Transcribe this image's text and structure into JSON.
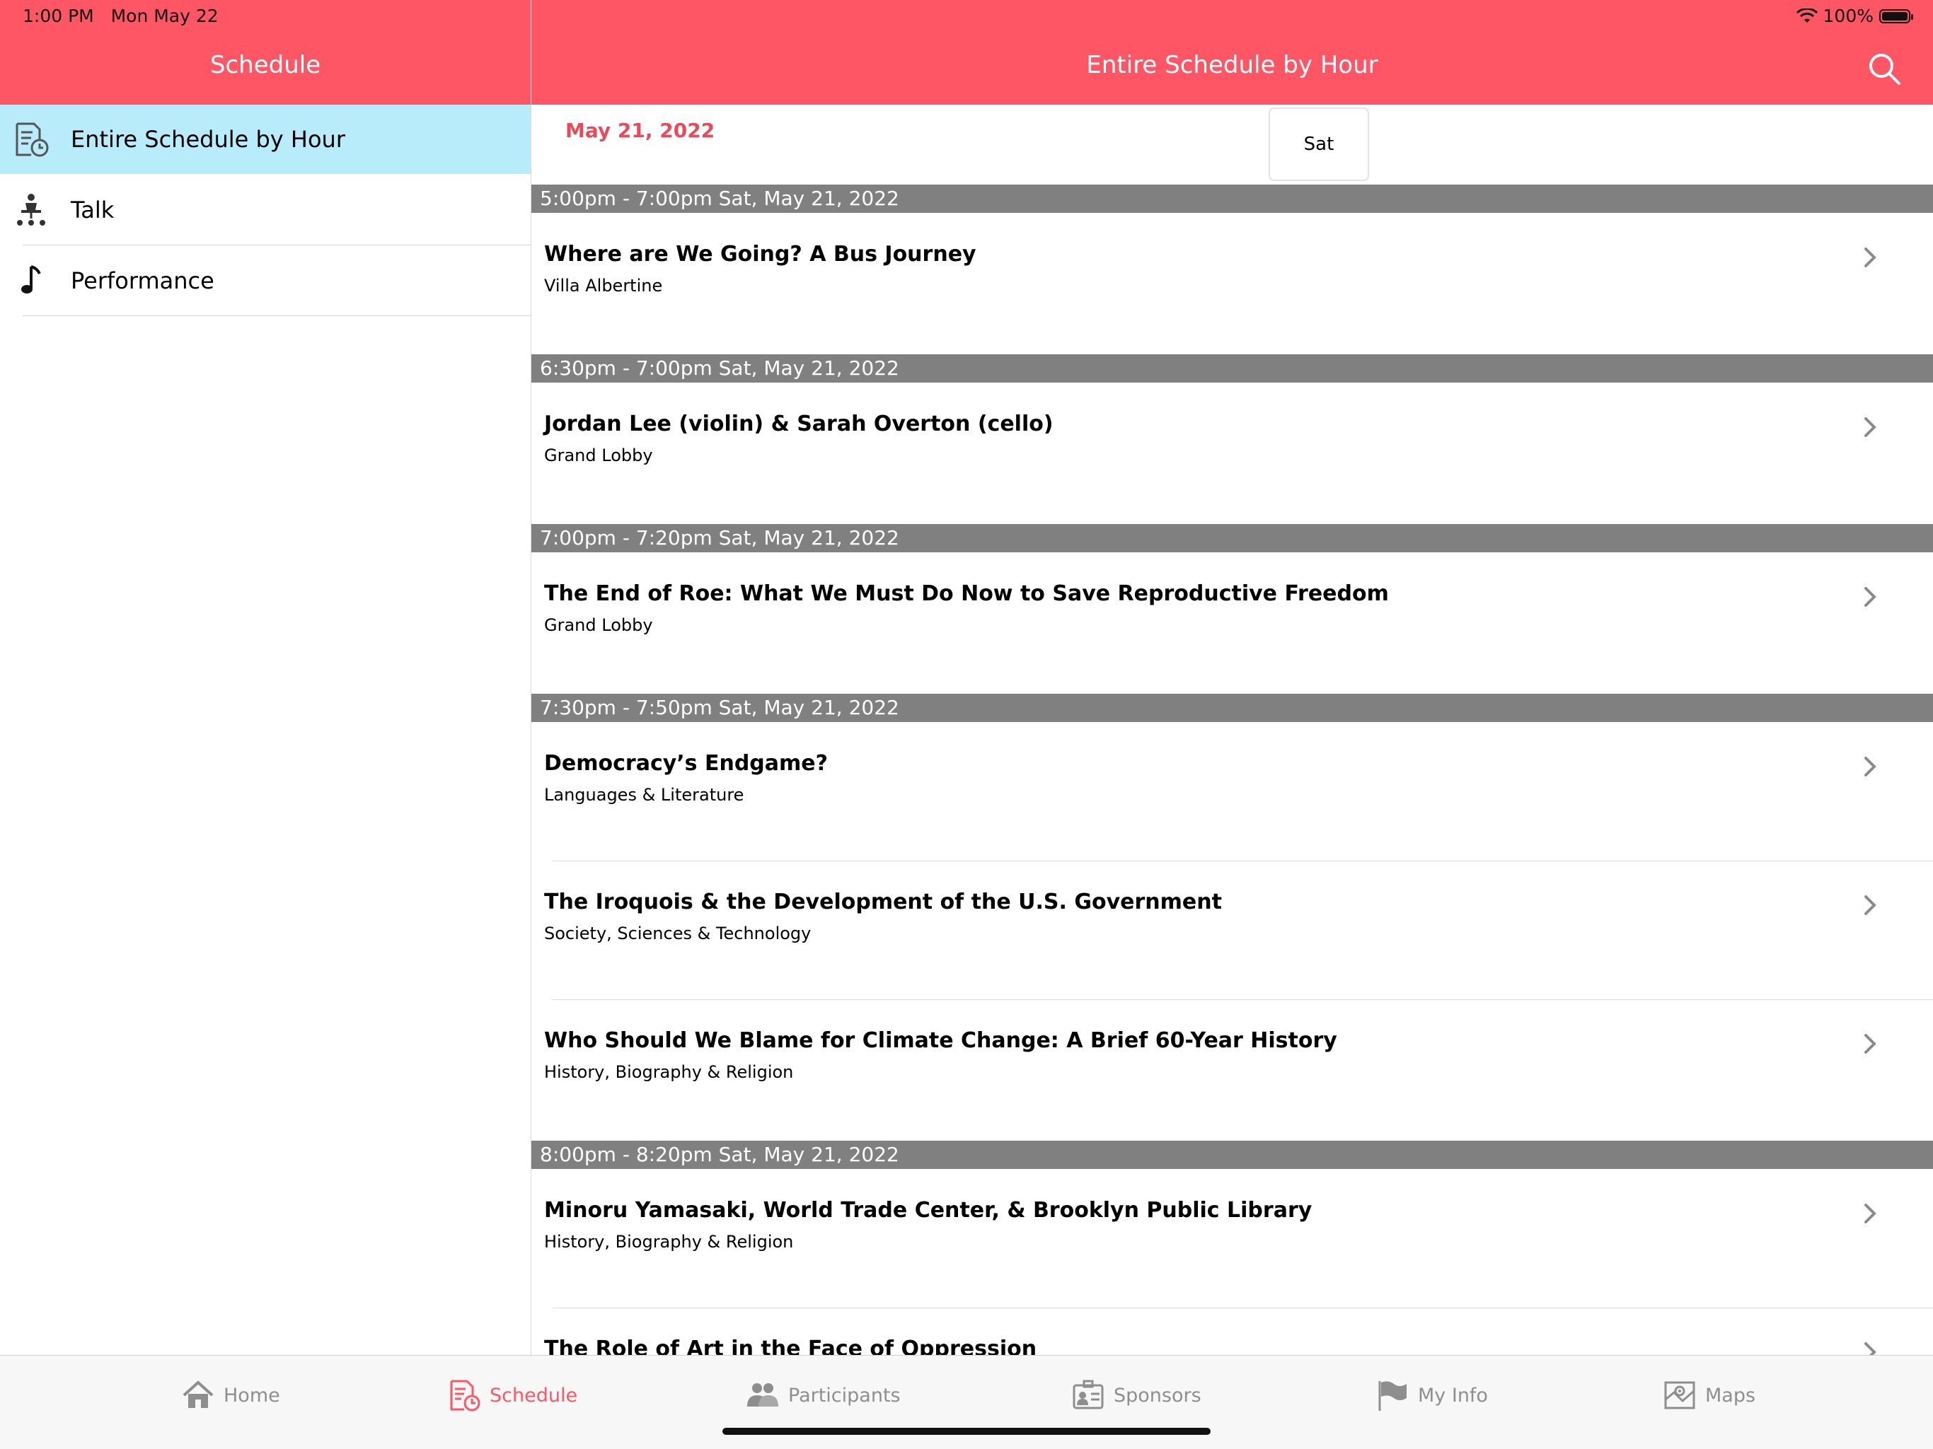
{
  "status_bar": {
    "time": "1:00 PM",
    "date": "Mon May 22",
    "battery": "100%"
  },
  "sidebar": {
    "title": "Schedule",
    "items": [
      {
        "label": "Entire Schedule by Hour",
        "icon": "schedule-clock-icon",
        "active": true
      },
      {
        "label": "Talk",
        "icon": "speaker-podium-icon",
        "active": false
      },
      {
        "label": "Performance",
        "icon": "music-note-icon",
        "active": false
      }
    ]
  },
  "main": {
    "title": "Entire Schedule by Hour",
    "date_label": "May 21, 2022",
    "day_button": "Sat",
    "slots": [
      {
        "time": "5:00pm - 7:00pm Sat, May 21, 2022"
      },
      {
        "time": "6:30pm - 7:00pm Sat, May 21, 2022"
      },
      {
        "time": "7:00pm - 7:20pm Sat, May 21, 2022"
      },
      {
        "time": "7:30pm - 7:50pm Sat, May 21, 2022"
      },
      {
        "time": "8:00pm - 8:20pm Sat, May 21, 2022"
      }
    ],
    "events": [
      {
        "title": "Where are We Going? A Bus Journey",
        "location": "Villa Albertine"
      },
      {
        "title": "Jordan Lee (violin) & Sarah Overton (cello)",
        "location": "Grand Lobby"
      },
      {
        "title": "The End of Roe: What We Must Do Now to Save Reproductive Freedom",
        "location": "Grand Lobby"
      },
      {
        "title": "Democracy’s Endgame?",
        "location": "Languages & Literature"
      },
      {
        "title": "The Iroquois & the Development of the U.S. Government",
        "location": "Society, Sciences & Technology"
      },
      {
        "title": "Who Should We Blame for Climate Change: A Brief 60-Year History",
        "location": "History, Biography & Religion"
      },
      {
        "title": "Minoru Yamasaki, World Trade Center, & Brooklyn Public Library",
        "location": "History, Biography & Religion"
      },
      {
        "title": "The Role of Art in the Face of Oppression",
        "location": ""
      }
    ]
  },
  "tabbar": {
    "tabs": [
      {
        "label": "Home",
        "icon": "home-icon",
        "active": false
      },
      {
        "label": "Schedule",
        "icon": "schedule-icon",
        "active": true
      },
      {
        "label": "Participants",
        "icon": "participants-icon",
        "active": false
      },
      {
        "label": "Sponsors",
        "icon": "sponsors-icon",
        "active": false
      },
      {
        "label": "My Info",
        "icon": "flag-icon",
        "active": false
      },
      {
        "label": "Maps",
        "icon": "map-icon",
        "active": false
      }
    ]
  },
  "colors": {
    "accent": "#ff5666",
    "selected_row": "#b9ecfb",
    "slot_header": "#808080",
    "date_text": "#e84a5a"
  }
}
